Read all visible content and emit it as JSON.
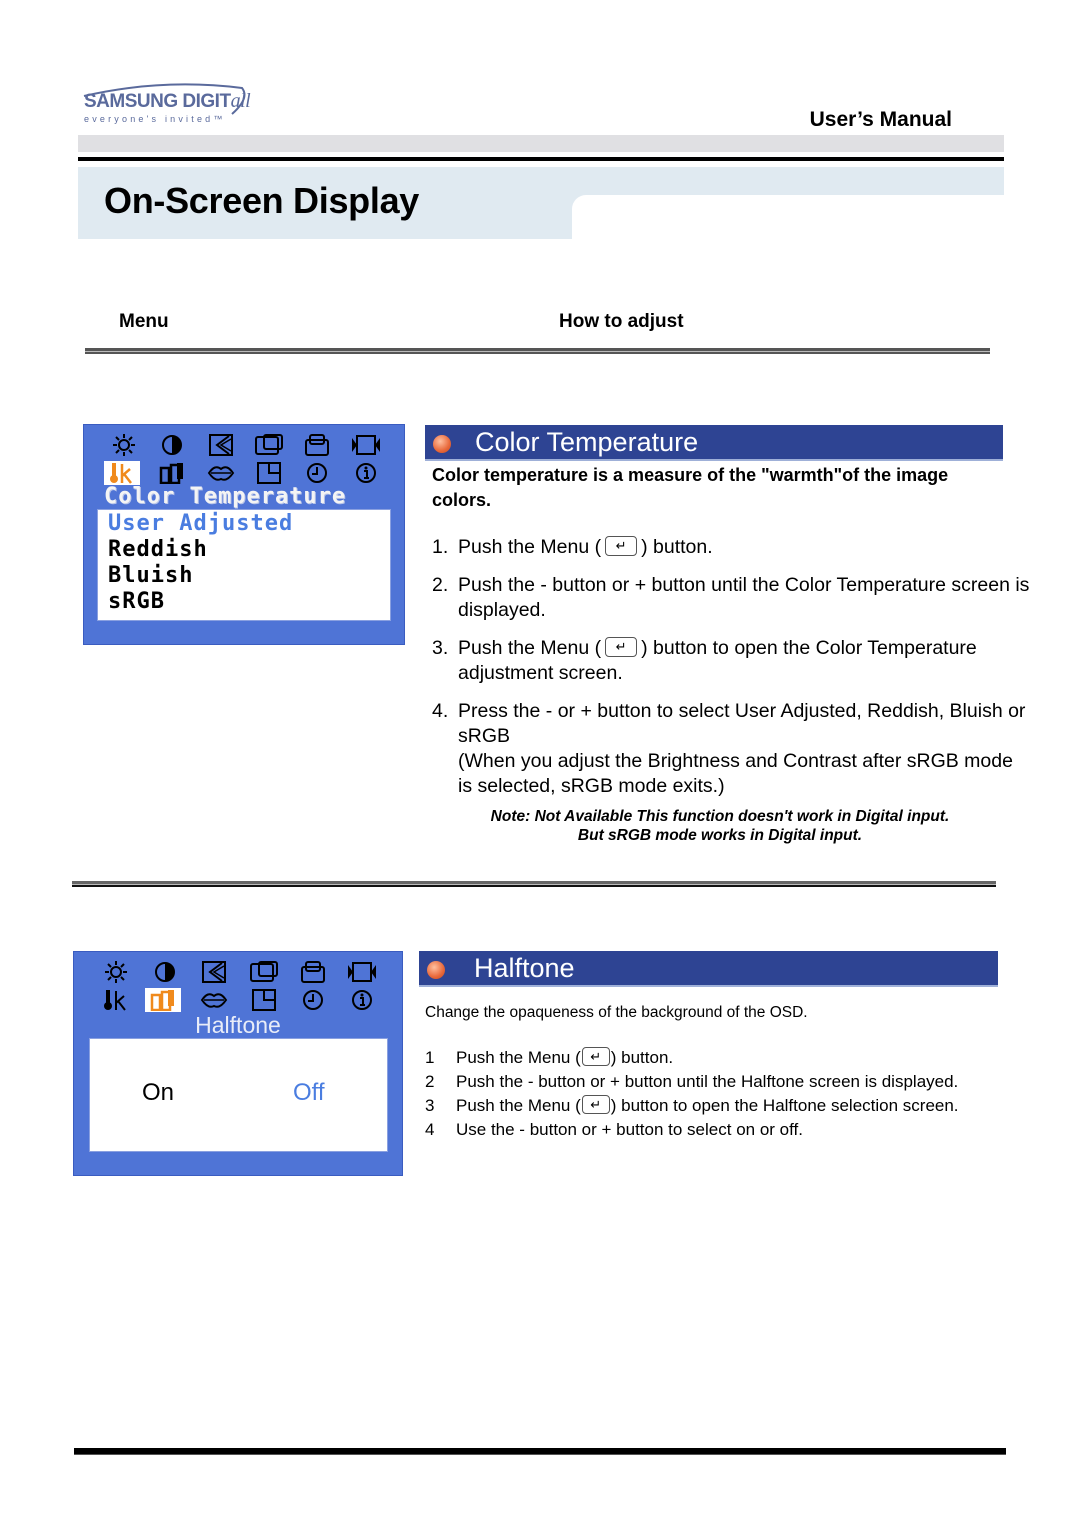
{
  "header": {
    "brand": "SAMSUNG DIGIT",
    "brand_suffix": "all",
    "tagline": "everyone's invited™",
    "manual_title": "User’s Manual",
    "page_title": "On-Screen Display"
  },
  "columns": {
    "menu": "Menu",
    "how_to_adjust": "How to adjust"
  },
  "menu_key_symbol": "↵",
  "color_temperature": {
    "section_title": "Color Temperature",
    "intro": "Color temperature is a measure of the \"warmth\"of the image colors.",
    "osd": {
      "icons_row1": [
        "brightness-icon",
        "contrast-icon",
        "position-icon",
        "size-icon",
        "image-lock-icon",
        "zoom-icon"
      ],
      "icons_row2": [
        "color-temperature-icon",
        "halftone-icon",
        "language-icon",
        "osd-position-icon",
        "osd-timer-icon",
        "information-icon"
      ],
      "selected_icon": "color-temperature-icon",
      "heading": "Color Temperature",
      "options": [
        "User Adjusted",
        "Reddish",
        "Bluish",
        "sRGB"
      ],
      "active_option": "User Adjusted"
    },
    "steps": [
      {
        "num": "1.",
        "pre": "Push the Menu (",
        "post": ") button."
      },
      {
        "num": "2.",
        "text": "Push the - button or + button until the Color Temperature screen is displayed."
      },
      {
        "num": "3.",
        "pre": "Push the Menu (",
        "post": ") button to open the Color Temperature adjustment screen."
      },
      {
        "num": "4.",
        "text": "Press the - or + button to select User Adjusted, Reddish, Bluish or sRGB",
        "subtext": "(When you adjust the Brightness and Contrast after sRGB mode is selected, sRGB mode exits.)"
      }
    ],
    "note_line1": "Note: Not Available  This function doesn't work in Digital input.",
    "note_line2": "But sRGB mode works in Digital input."
  },
  "halftone": {
    "section_title": "Halftone",
    "intro": "Change the opaqueness of the background of the OSD.",
    "osd": {
      "selected_icon": "halftone-icon",
      "heading": "Halftone",
      "option_on": "On",
      "option_off": "Off",
      "active_option": "Off"
    },
    "steps": [
      {
        "num": "1",
        "pre": "Push the Menu (",
        "post": ") button."
      },
      {
        "num": "2",
        "text": "Push the - button or + button until the Halftone screen is displayed."
      },
      {
        "num": "3",
        "pre": "Push the Menu (",
        "post": ") button to open the Halftone selection screen."
      },
      {
        "num": "4",
        "text": "Use the - button or + button to select on or off."
      }
    ]
  },
  "colors": {
    "osd_blue": "#4f74d6",
    "section_bar": "#2e4493",
    "title_band": "#e0eaf1",
    "active_option": "#4a7de0",
    "selected_icon": "#f08a1c"
  }
}
